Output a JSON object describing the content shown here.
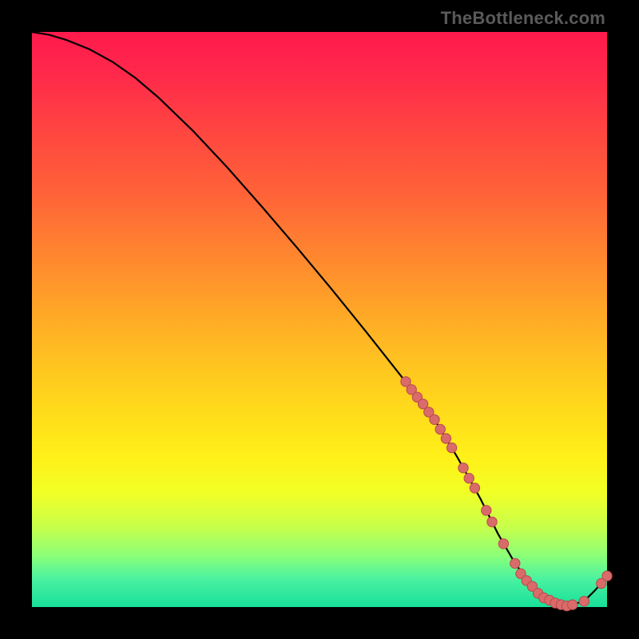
{
  "watermark": "TheBottleneck.com",
  "colors": {
    "curve": "#000000",
    "marker_fill": "#d96b6b",
    "marker_stroke": "#b84a4a",
    "gradient_top": "#ff1a4d",
    "gradient_bottom": "#17e09a",
    "page_bg": "#000000"
  },
  "chart_data": {
    "type": "line",
    "title": "",
    "xlabel": "",
    "ylabel": "",
    "xlim": [
      0,
      100
    ],
    "ylim": [
      0,
      100
    ],
    "grid": false,
    "legend": null,
    "curve": {
      "x": [
        0,
        3,
        6,
        10,
        14,
        18,
        22,
        28,
        34,
        40,
        46,
        52,
        58,
        64,
        70,
        74,
        78,
        81,
        84,
        87,
        90,
        93,
        96,
        98,
        100
      ],
      "y": [
        100,
        99.5,
        98.6,
        97.0,
        94.8,
        92.0,
        88.6,
        82.8,
        76.4,
        69.6,
        62.6,
        55.4,
        48.0,
        40.4,
        32.6,
        26.0,
        18.8,
        12.8,
        7.6,
        3.6,
        1.2,
        0.2,
        1.0,
        3.0,
        5.4
      ]
    },
    "markers": [
      {
        "x": 65,
        "y": 39.2
      },
      {
        "x": 66,
        "y": 37.8
      },
      {
        "x": 67,
        "y": 36.5
      },
      {
        "x": 68,
        "y": 35.3
      },
      {
        "x": 69,
        "y": 33.9
      },
      {
        "x": 70,
        "y": 32.6
      },
      {
        "x": 71,
        "y": 30.9
      },
      {
        "x": 72,
        "y": 29.3
      },
      {
        "x": 73,
        "y": 27.7
      },
      {
        "x": 75,
        "y": 24.2
      },
      {
        "x": 76,
        "y": 22.4
      },
      {
        "x": 77,
        "y": 20.7
      },
      {
        "x": 79,
        "y": 16.8
      },
      {
        "x": 80,
        "y": 14.8
      },
      {
        "x": 82,
        "y": 11.0
      },
      {
        "x": 84,
        "y": 7.6
      },
      {
        "x": 85,
        "y": 5.8
      },
      {
        "x": 86,
        "y": 4.6
      },
      {
        "x": 87,
        "y": 3.6
      },
      {
        "x": 88,
        "y": 2.4
      },
      {
        "x": 89,
        "y": 1.6
      },
      {
        "x": 90,
        "y": 1.2
      },
      {
        "x": 91,
        "y": 0.7
      },
      {
        "x": 92,
        "y": 0.4
      },
      {
        "x": 93,
        "y": 0.2
      },
      {
        "x": 94,
        "y": 0.4
      },
      {
        "x": 96,
        "y": 1.0
      },
      {
        "x": 99,
        "y": 4.1
      },
      {
        "x": 100,
        "y": 5.4
      }
    ]
  }
}
